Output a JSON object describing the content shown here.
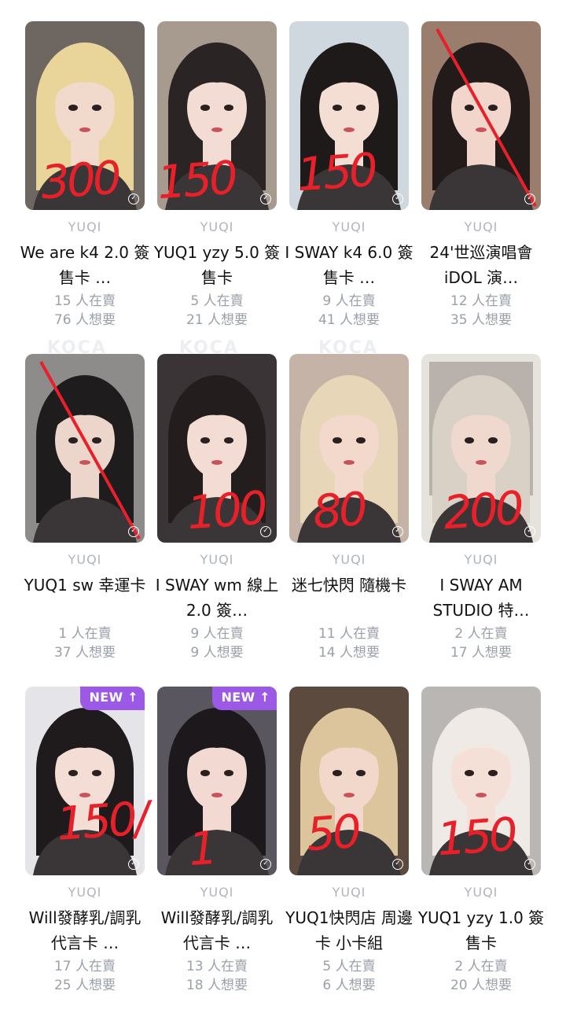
{
  "cards": [
    {
      "artist": "YUQI",
      "title": "We are k4 2.0 簽售卡 …",
      "sellers": "15 人在賣",
      "wanters": "76 人想要",
      "price": "300",
      "new": false,
      "bg": "#6e6660",
      "skin": "#f1d9cc",
      "hair": "#e9d59a"
    },
    {
      "artist": "YUQI",
      "title": "YUQ1 yzy 5.0 簽售卡",
      "sellers": "5 人在賣",
      "wanters": "21 人想要",
      "price": "150",
      "new": false,
      "bg": "#a79a8e",
      "skin": "#f3dcd3",
      "hair": "#2b2424"
    },
    {
      "artist": "YUQI",
      "title": "I SWAY k4 6.0 簽售卡 …",
      "sellers": "9 人在賣",
      "wanters": "41 人想要",
      "price": "150",
      "new": false,
      "bg": "#cfd7df",
      "skin": "#f4ddd3",
      "hair": "#1e1a1a"
    },
    {
      "artist": "YUQI",
      "title": "24'世巡演唱會 iDOL 演…",
      "sellers": "12 人在賣",
      "wanters": "35 人想要",
      "price": "",
      "new": false,
      "bg": "#9a7d6d",
      "skin": "#f2d6cc",
      "hair": "#221b1a",
      "slash": true
    },
    {
      "artist": "YUQI",
      "title": "YUQ1 sw 幸運卡",
      "sellers": "1 人在賣",
      "wanters": "37 人想要",
      "price": "",
      "new": false,
      "bg": "#8e8c8a",
      "skin": "#ecd6cc",
      "hair": "#1e1c1c",
      "slash": true
    },
    {
      "artist": "YUQI",
      "title": "I SWAY wm 線上2.0 簽…",
      "sellers": "9 人在賣",
      "wanters": "9 人想要",
      "price": "100",
      "new": false,
      "bg": "#3a3436",
      "skin": "#f3dcd3",
      "hair": "#241d1e"
    },
    {
      "artist": "YUQI",
      "title": "迷七快閃 隨機卡",
      "sellers": "11 人在賣",
      "wanters": "14 人想要",
      "price": "80",
      "new": false,
      "bg": "#c4b3a6",
      "skin": "#f2d9cc",
      "hair": "#e7d6b8"
    },
    {
      "artist": "YUQI",
      "title": "I SWAY AM STUDIO 特…",
      "sellers": "2 人在賣",
      "wanters": "17 人想要",
      "price": "200",
      "new": false,
      "bg": "#e6e3dd",
      "skin": "#efd9cf",
      "hair": "#d9d1c6",
      "frame": true
    },
    {
      "artist": "YUQI",
      "title": "Will發酵乳/調乳 代言卡 …",
      "sellers": "17 人在賣",
      "wanters": "25 人想要",
      "price": "150/",
      "new": true,
      "new_label": "NEW ↑",
      "bg": "#e5e4e8",
      "skin": "#f4ddd5",
      "hair": "#1f1b1d"
    },
    {
      "artist": "YUQI",
      "title": "Will發酵乳/調乳 代言卡 …",
      "sellers": "13 人在賣",
      "wanters": "18 人想要",
      "price": "1",
      "new": true,
      "new_label": "NEW ↑",
      "bg": "#5a5660",
      "skin": "#f2dad2",
      "hair": "#1c181b"
    },
    {
      "artist": "YUQI",
      "title": "YUQ1快閃店 周邊卡 小卡組",
      "sellers": "5 人在賣",
      "wanters": "6 人想要",
      "price": "50",
      "new": false,
      "bg": "#5d4a3e",
      "skin": "#f2d8cb",
      "hair": "#dcc59c"
    },
    {
      "artist": "YUQI",
      "title": "YUQ1 yzy 1.0 簽售卡",
      "sellers": "2 人在賣",
      "wanters": "20 人想要",
      "price": "150",
      "new": false,
      "bg": "#b9b6b4",
      "skin": "#f5e0d8",
      "hair": "#efeae6"
    }
  ],
  "watermark_text": "KOCA",
  "check_glyph": "✓",
  "accent": "#9b59e6",
  "price_color": "#e8202a"
}
